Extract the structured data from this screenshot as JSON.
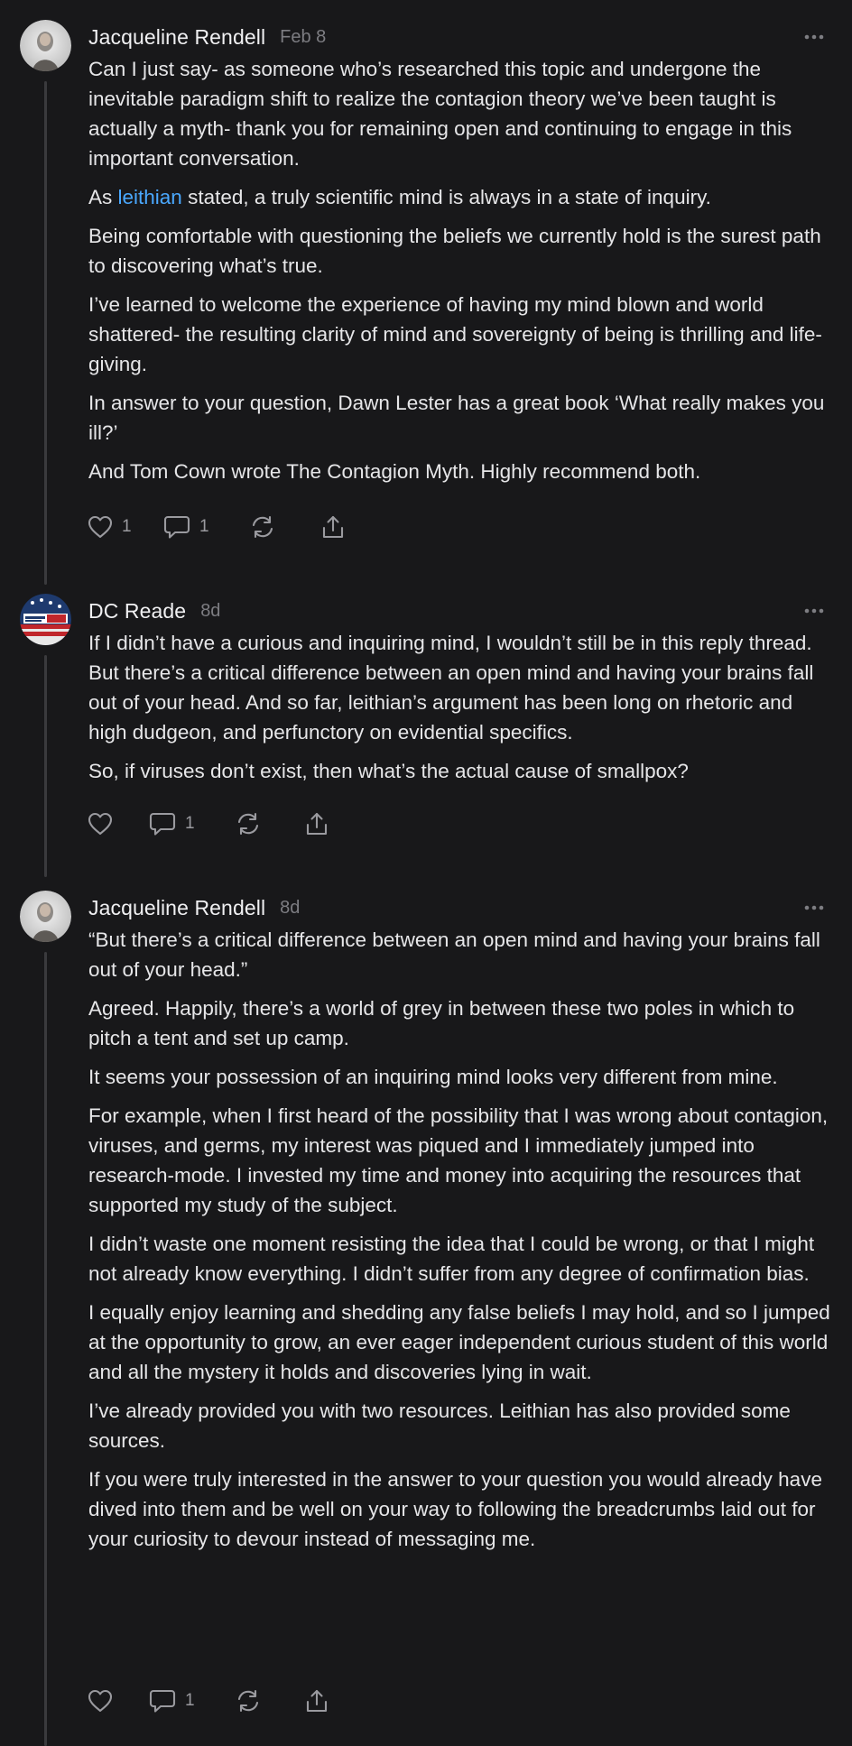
{
  "comments": [
    {
      "author": "Jacqueline Rendell",
      "date": "Feb 8",
      "more_label": "···",
      "paragraphs": [
        "Can I just say- as someone who’s researched this topic and undergone the inevitable paradigm shift to realize the contagion theory we’ve been taught is actually a myth- thank you for remaining open and continuing to engage in this important conversation.",
        "Being comfortable with questioning the beliefs we currently hold is the surest path to discovering what’s true.",
        "I’ve learned to welcome the experience of having my mind blown and world shattered- the resulting clarity of mind and sovereignty of being is thrilling and life-giving.",
        "In answer to your question, Dawn Lester has a great book ‘What really makes you ill?’",
        "And Tom Cown wrote The Contagion Myth. Highly recommend both."
      ],
      "mention_para": {
        "before": "As ",
        "mention": "leithian",
        "after": " stated, a truly scientific mind is always in a state of inquiry."
      },
      "likes": "1",
      "replies": "1"
    },
    {
      "author": "DC Reade",
      "date": "8d",
      "more_label": "···",
      "paragraphs": [
        "If I didn’t have a curious and inquiring mind, I wouldn’t still be in this reply thread. But there’s a critical difference between an open mind and having your brains fall out of your head. And so far, leithian’s argument has been long on rhetoric and high dudgeon, and perfunctory on evidential specifics.",
        "So, if viruses don’t exist, then what’s the actual cause of smallpox?"
      ],
      "likes": "",
      "replies": "1"
    },
    {
      "author": "Jacqueline Rendell",
      "date": "8d",
      "more_label": "···",
      "paragraphs": [
        "“But there’s a critical difference between an open mind and having your brains fall out of your head.”",
        "Agreed. Happily, there’s a world of grey in between these two poles in which to pitch a tent and set up camp.",
        "It seems your possession of an inquiring mind looks very different from mine.",
        "For example, when I first heard of the possibility that I was wrong about contagion, viruses, and germs, my interest was piqued and I immediately jumped into research-mode. I invested my time and money into acquiring the resources that supported my study of the subject.",
        "I didn’t waste one moment resisting the idea that I could be wrong, or that I might not already know everything. I didn’t suffer from any degree of confirmation bias.",
        "I equally enjoy learning and shedding any false beliefs I may hold, and so I jumped at the opportunity to grow, an ever eager independent curious student of this world and all the mystery it holds and discoveries lying in wait.",
        "I’ve already provided you with two resources. Leithian has also provided some sources.",
        "If you were truly interested in the answer to your question you would already have dived into them and be well on your way to following the breadcrumbs laid out for your curiosity to devour instead of messaging me."
      ],
      "likes": "",
      "replies": "1"
    }
  ],
  "icons": {
    "like": "heart-icon",
    "reply": "comment-icon",
    "restack": "restack-icon",
    "share": "share-icon",
    "more": "more-icon"
  },
  "colors": {
    "background": "#18181a",
    "text": "#e6e6e8",
    "muted": "#7d7d82",
    "mention": "#4aa8ff",
    "thread_line": "#3a3a3d"
  }
}
